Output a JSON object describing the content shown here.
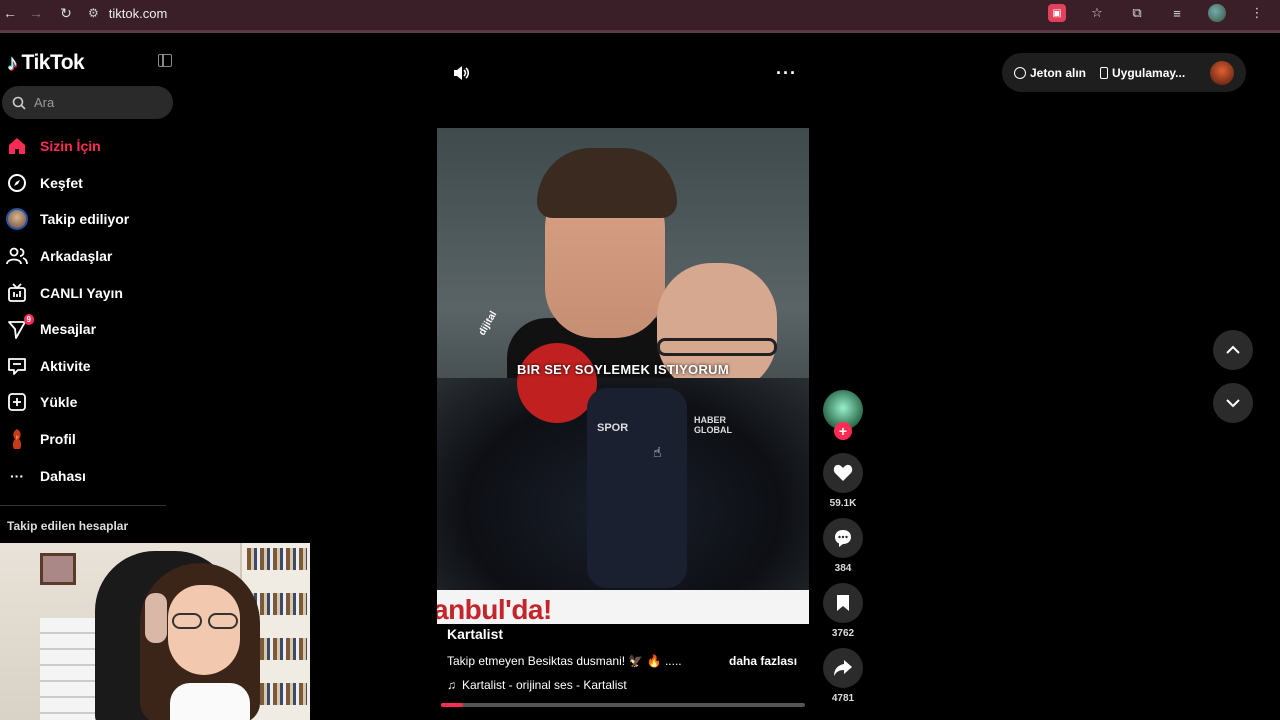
{
  "browser": {
    "url": "tiktok.com"
  },
  "sidebar": {
    "logo": "TikTok",
    "search_placeholder": "Ara",
    "items": [
      {
        "label": "Sizin İçin",
        "icon": "home-icon",
        "active": true
      },
      {
        "label": "Keşfet",
        "icon": "compass-icon"
      },
      {
        "label": "Takip ediliyor",
        "icon": "following-avatar"
      },
      {
        "label": "Arkadaşlar",
        "icon": "friends-icon"
      },
      {
        "label": "CANLI Yayın",
        "icon": "live-tv-icon"
      },
      {
        "label": "Mesajlar",
        "icon": "message-send-icon",
        "badge": "9"
      },
      {
        "label": "Aktivite",
        "icon": "activity-icon"
      },
      {
        "label": "Yükle",
        "icon": "upload-plus-icon"
      },
      {
        "label": "Profil",
        "icon": "profile-avatar"
      },
      {
        "label": "Dahası",
        "icon": "more-dots-icon"
      }
    ],
    "following_title": "Takip edilen hesaplar"
  },
  "topbar": {
    "coins_label": "Jeton alın",
    "app_label": "Uygulamay..."
  },
  "video": {
    "caption": "BIR SEY SOYLEMEK ISTIYORUM",
    "mic_text_1": "SPOR",
    "mic_text_2": "HABER GLOBAL",
    "mic_text_3": "dijital",
    "banner_text": "anbul'da!",
    "progress_fraction": 0.06
  },
  "info": {
    "author": "Kartalist",
    "description": "Takip etmeyen Besiktas dusmani! 🦅 🔥 .....",
    "more_label": "daha fazlası",
    "music": "Kartalist - orijinal ses - Kartalist"
  },
  "actions": {
    "likes": "59.1K",
    "comments": "384",
    "saves": "3762",
    "shares": "4781"
  },
  "colors": {
    "accent": "#fe2c55",
    "chrome": "#3a1f28",
    "background": "#000000"
  }
}
